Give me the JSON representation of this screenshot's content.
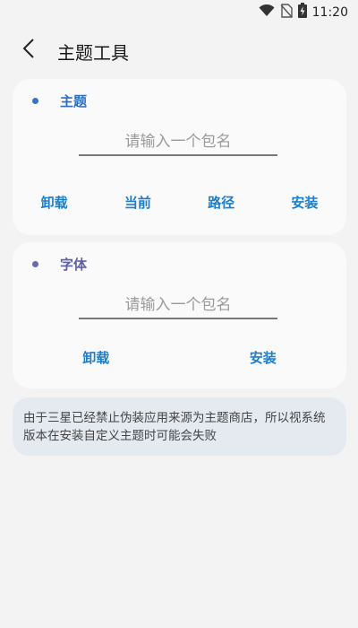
{
  "status_bar": {
    "time": "11:20",
    "icons": [
      "wifi-icon",
      "no-sim-icon",
      "battery-charging-icon"
    ]
  },
  "app_bar": {
    "back_icon": "chevron-left-icon",
    "title": "主题工具"
  },
  "theme_card": {
    "label": "主题",
    "input_placeholder": "请输入一个包名",
    "input_value": "",
    "buttons": [
      "卸载",
      "当前",
      "路径",
      "安装"
    ]
  },
  "font_card": {
    "label": "字体",
    "input_placeholder": "请输入一个包名",
    "input_value": "",
    "buttons": [
      "卸载",
      "安装"
    ]
  },
  "notice": {
    "text": "由于三星已经禁止伪装应用来源为主题商店，所以视系统版本在安装自定义主题时可能会失败"
  },
  "colors": {
    "theme_accent": "#2f6fc0",
    "font_accent": "#5f5fa6",
    "button_text": "#1e7ec8",
    "background": "#f3f3f3",
    "card": "#fafafa",
    "notice_bg": "#e5eaf1"
  }
}
